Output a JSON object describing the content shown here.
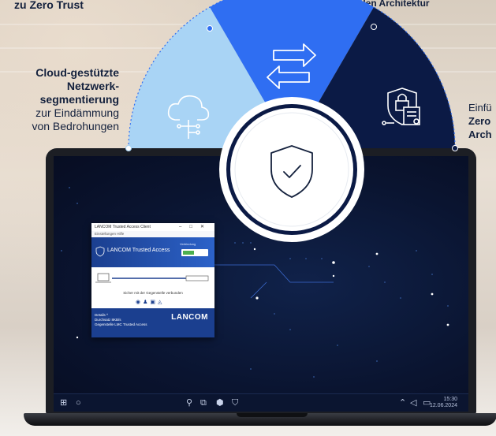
{
  "captions": {
    "top_left": "zu Zero Trust",
    "top_right": "hybriden Architektur",
    "left_line1": "Cloud-gestützte",
    "left_line2": "Netzwerk-",
    "left_line3": "segmentierung",
    "left_line4": "zur Eindämmung",
    "left_line5": "von Bedrohungen",
    "right_line1": "Einfü",
    "right_line2": "Zero",
    "right_line3": "Arch"
  },
  "colors": {
    "segment_left": "#a9d4f5",
    "segment_mid": "#2f6ef2",
    "segment_right": "#0b1a45",
    "text_dark": "#14213d"
  },
  "icons": [
    "cloud-network-icon",
    "transfer-arrows-icon",
    "lock-certificate-icon",
    "shield-check-icon"
  ],
  "app_window": {
    "title": "LANCOM Trusted Access Client",
    "menu": "Einstellungen   Hilfe",
    "brand": "LANCOM Trusted Access",
    "toggle_label": "Verbindung",
    "status": "Sicher mit der Gegenstelle verbunden",
    "footer_line1": "Details   ^",
    "footer_line2": "Durchsatz 8KB/s",
    "footer_line3": "Gegenstelle      LMC Trusted Access",
    "logo": "LANCOM"
  },
  "taskbar": {
    "time": "15:30",
    "date": "12.06.2024"
  }
}
